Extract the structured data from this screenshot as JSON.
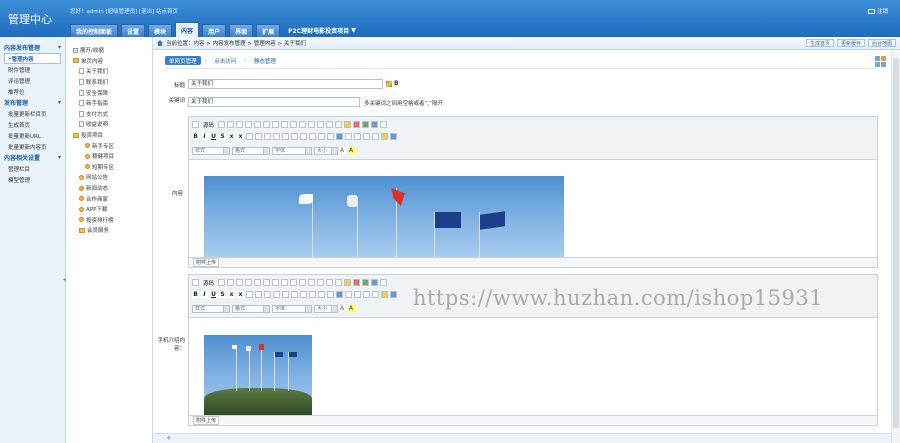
{
  "app": {
    "brand": "管理中心",
    "userline": "您好！admin [超级管理员] [退出] 站点首页",
    "logout": "注销"
  },
  "nav": {
    "tabs": [
      {
        "label": "我的面板",
        "active": false
      },
      {
        "label": "设置",
        "active": false
      },
      {
        "label": "模块",
        "active": false
      },
      {
        "label": "内容",
        "active": true
      },
      {
        "label": "用户",
        "active": false
      },
      {
        "label": "界面",
        "active": false
      },
      {
        "label": "扩展",
        "active": false
      }
    ],
    "special_tab": "P2C理财电影投资项目",
    "home_tab": "我的控制面板"
  },
  "sidebar": {
    "sections": [
      {
        "title": "内容发布管理",
        "items": [
          {
            "label": "管理内容",
            "active": true
          },
          {
            "label": "附件管理",
            "active": false
          },
          {
            "label": "评论管理",
            "active": false
          },
          {
            "label": "推荐位",
            "active": false
          }
        ]
      },
      {
        "title": "发布管理",
        "items": [
          {
            "label": "批量更新栏目页",
            "active": false
          },
          {
            "label": "生成首页",
            "active": false
          },
          {
            "label": "批量更新URL",
            "active": false
          },
          {
            "label": "批量更新内容页",
            "active": false
          }
        ]
      },
      {
        "title": "内容相关设置",
        "items": [
          {
            "label": "管理栏目",
            "active": false
          },
          {
            "label": "模型管理",
            "active": false
          }
        ]
      }
    ]
  },
  "tree": {
    "nodes": [
      {
        "label": "展开/收缩",
        "depth": 0,
        "icon": "box"
      },
      {
        "label": "单页内容",
        "depth": 0,
        "icon": "fold"
      },
      {
        "label": "关于我们",
        "depth": 1,
        "icon": "doc"
      },
      {
        "label": "联系我们",
        "depth": 1,
        "icon": "doc"
      },
      {
        "label": "安全保障",
        "depth": 1,
        "icon": "doc"
      },
      {
        "label": "新手指南",
        "depth": 1,
        "icon": "doc"
      },
      {
        "label": "支付方式",
        "depth": 1,
        "icon": "doc"
      },
      {
        "label": "收益说明",
        "depth": 1,
        "icon": "doc"
      },
      {
        "label": "投资项目",
        "depth": 0,
        "icon": "fold"
      },
      {
        "label": "新手专区",
        "depth": 2,
        "icon": "ring"
      },
      {
        "label": "稳健项目",
        "depth": 2,
        "icon": "ring"
      },
      {
        "label": "短期专区",
        "depth": 2,
        "icon": "ring"
      },
      {
        "label": "网站公告",
        "depth": 1,
        "icon": "ring"
      },
      {
        "label": "新闻动态",
        "depth": 1,
        "icon": "ring"
      },
      {
        "label": "合作商家",
        "depth": 1,
        "icon": "ring"
      },
      {
        "label": "APP下载",
        "depth": 1,
        "icon": "ring"
      },
      {
        "label": "投资排行榜",
        "depth": 1,
        "icon": "ring"
      },
      {
        "label": "会员服务",
        "depth": 1,
        "icon": "fold"
      }
    ]
  },
  "breadcrumb": {
    "text": "当前位置：内容 > 内容发布管理 > 管理内容 > 关于我们",
    "actions": [
      "生成首页",
      "更新缓存",
      "后台地图"
    ]
  },
  "subtabs": [
    "单网页管理",
    "点击访问",
    "静态管理"
  ],
  "form": {
    "title_label": "标题",
    "title_value": "关于我们",
    "keyword_label": "关键词",
    "keyword_value": "关于我们",
    "keyword_hint": "多关键词之间用空格或者“,”隔开",
    "content_label": "内容",
    "mobile_label": "手机介绍内容："
  },
  "editor": {
    "source_label": "源码",
    "selects": [
      "样式",
      "格式",
      "字体",
      "大小"
    ],
    "attach_label": "附件上传"
  },
  "watermark": "https://www.huzhan.com/ishop15931",
  "addbar": "+"
}
